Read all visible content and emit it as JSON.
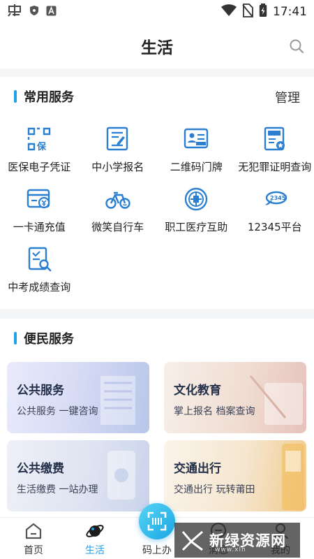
{
  "status_bar": {
    "time": "17:41",
    "icons": [
      "app-notify-icon",
      "shield-icon",
      "a-badge-icon",
      "wifi-icon",
      "no-sim-icon",
      "battery-charging-icon"
    ]
  },
  "header": {
    "title": "生活",
    "search_icon": "search-icon"
  },
  "common_services": {
    "title": "常用服务",
    "action": "管理",
    "items": [
      {
        "label": "医保电子凭证",
        "icon": "medical-insurance-icon"
      },
      {
        "label": "中小学报名",
        "icon": "school-registration-icon"
      },
      {
        "label": "二维码门牌",
        "icon": "qr-doorplate-icon"
      },
      {
        "label": "无犯罪证明查询",
        "icon": "no-crime-certificate-icon"
      },
      {
        "label": "一卡通充值",
        "icon": "card-recharge-icon"
      },
      {
        "label": "微笑自行车",
        "icon": "bicycle-icon"
      },
      {
        "label": "职工医疗互助",
        "icon": "worker-medical-icon"
      },
      {
        "label": "12345平台",
        "icon": "hotline-12345-icon"
      },
      {
        "label": "中考成绩查询",
        "icon": "exam-score-icon"
      }
    ]
  },
  "convenience_services": {
    "title": "便民服务",
    "cards": [
      {
        "title": "公共服务",
        "subtitle": "公共服务 一键咨询"
      },
      {
        "title": "文化教育",
        "subtitle": "掌上报名 档案查询"
      },
      {
        "title": "公共缴费",
        "subtitle": "生活缴费 一站办理"
      },
      {
        "title": "交通出行",
        "subtitle": "交通出行 玩转莆田"
      }
    ]
  },
  "bottom_nav": {
    "items": [
      {
        "label": "首页",
        "icon": "home-icon"
      },
      {
        "label": "生活",
        "icon": "planet-icon"
      },
      {
        "label": "码上办",
        "icon": "scan-icon"
      },
      {
        "label": "消息",
        "icon": "message-icon"
      },
      {
        "label": "我的",
        "icon": "profile-icon"
      }
    ],
    "active": "生活"
  },
  "watermark": {
    "text": "新绿资源网",
    "sub": "www.xlh"
  },
  "colors": {
    "accent": "#1ea1e8",
    "icon_blue": "#2a7fd0"
  }
}
